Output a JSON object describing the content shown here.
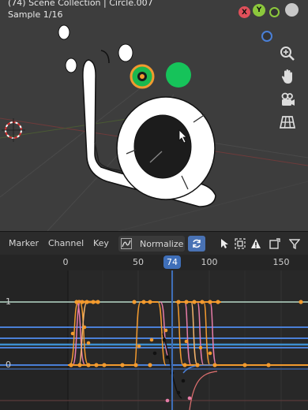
{
  "viewport": {
    "title": "(74) Scene Collection | Circle.007",
    "sample": "Sample 1/16",
    "gizmo": {
      "x": "X",
      "y": "Y"
    },
    "nav_icons": [
      "zoom-icon",
      "hand-pan-icon",
      "camera-icon",
      "grid-view-icon"
    ]
  },
  "graph_header": {
    "menus": [
      "Marker",
      "Channel",
      "Key"
    ],
    "normalize_label": "Normalize",
    "icons": [
      "curve-handle-icon",
      "refresh-icon",
      "cursor-icon",
      "frame-icon",
      "warning-icon",
      "box-icon",
      "filter-icon"
    ]
  },
  "timeline": {
    "ticks": [
      "0",
      "50",
      "100",
      "150"
    ],
    "current_frame": "74",
    "y_labels": [
      "1",
      "0"
    ]
  },
  "colors": {
    "accent_blue": "#3f6fb9",
    "curve_orange": "#f29a2e",
    "curve_blue": "#4a7fd6",
    "curve_pink": "#e67ca8",
    "green_object": "#16c35a"
  }
}
